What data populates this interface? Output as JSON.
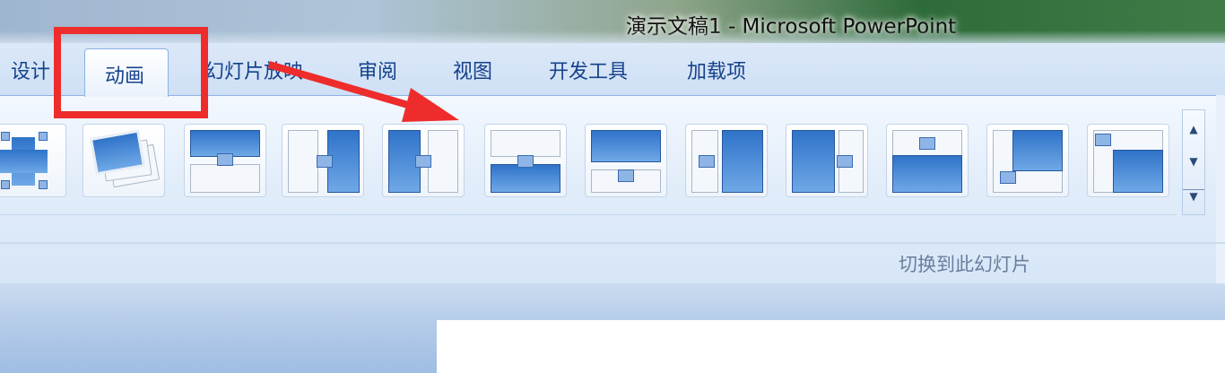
{
  "window": {
    "title": "演示文稿1 - Microsoft PowerPoint"
  },
  "tabs": [
    {
      "label": "设计"
    },
    {
      "label": "动画",
      "selected": true
    },
    {
      "label": "幻灯片放映"
    },
    {
      "label": "审阅"
    },
    {
      "label": "视图"
    },
    {
      "label": "开发工具"
    },
    {
      "label": "加载项"
    }
  ],
  "ribbon": {
    "group_label": "切换到此幻灯片",
    "transitions": [
      "zoom-out",
      "zoom-stack",
      "cover-down",
      "cover-left",
      "cover-right",
      "push-up",
      "push-down",
      "push-left",
      "push-right",
      "uncover-up",
      "cover-left-down",
      "uncover-left-up"
    ],
    "scroll": {
      "up": "▲",
      "down": "▼",
      "more": "▼"
    }
  },
  "annotation": {
    "box_color": "#ee2c2c",
    "arrow_color": "#ee2c2c"
  }
}
